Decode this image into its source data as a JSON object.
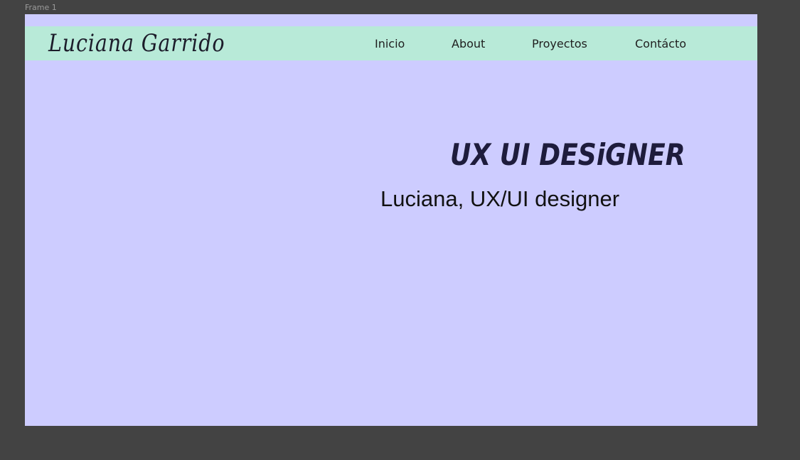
{
  "frame": {
    "label": "Frame 1"
  },
  "navbar": {
    "logo": "Luciana Garrido",
    "items": [
      {
        "label": "Inicio"
      },
      {
        "label": "About"
      },
      {
        "label": "Proyectos"
      },
      {
        "label": "Contácto"
      }
    ]
  },
  "hero": {
    "title": "UX UI DESiGNER",
    "subtitle": "Luciana, UX/UI designer"
  },
  "colors": {
    "canvas_background": "#434343",
    "frame_background": "#cdccff",
    "navbar_background": "#b8ead8",
    "title_color": "#1e1c3c"
  }
}
